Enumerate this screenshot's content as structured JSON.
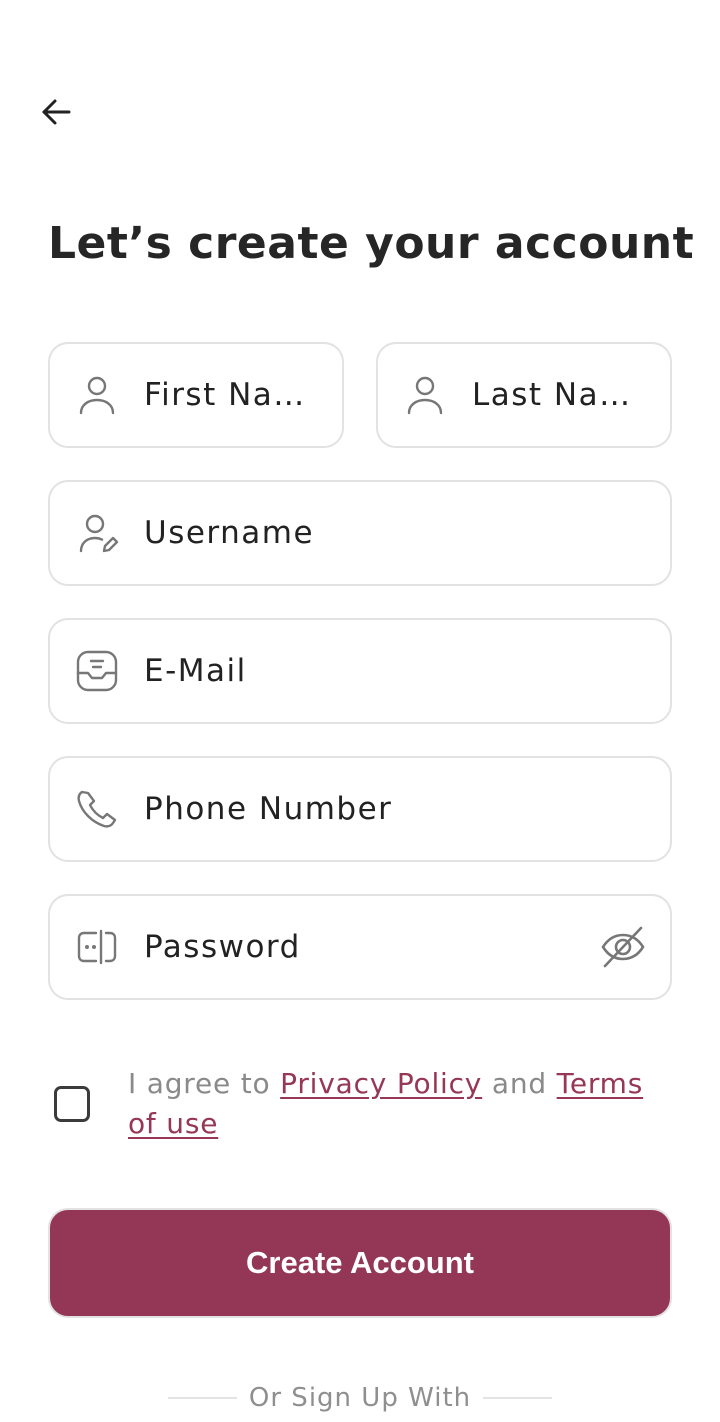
{
  "header": {
    "back_icon": "arrow-left-icon"
  },
  "title": "Let’s create your account",
  "form": {
    "first_name": {
      "placeholder": "First Na…",
      "icon": "user-icon"
    },
    "last_name": {
      "placeholder": "Last Na…",
      "icon": "user-icon"
    },
    "username": {
      "placeholder": "Username",
      "icon": "user-edit-icon"
    },
    "email": {
      "placeholder": "E-Mail",
      "icon": "inbox-icon"
    },
    "phone": {
      "placeholder": "Phone Number",
      "icon": "phone-icon"
    },
    "password": {
      "placeholder": "Password",
      "icon": "password-check-icon",
      "toggle_icon": "eye-slash-icon"
    }
  },
  "agreement": {
    "prefix": "I agree to ",
    "privacy_link": "Privacy Policy",
    "middle": " and ",
    "terms_link": "Terms of use",
    "checked": false
  },
  "create_button": "Create Account",
  "divider_text": "Or Sign Up With",
  "colors": {
    "primary": "#943655",
    "border": "#e2e2e2",
    "text": "#222222",
    "muted": "#8a8a8a"
  }
}
